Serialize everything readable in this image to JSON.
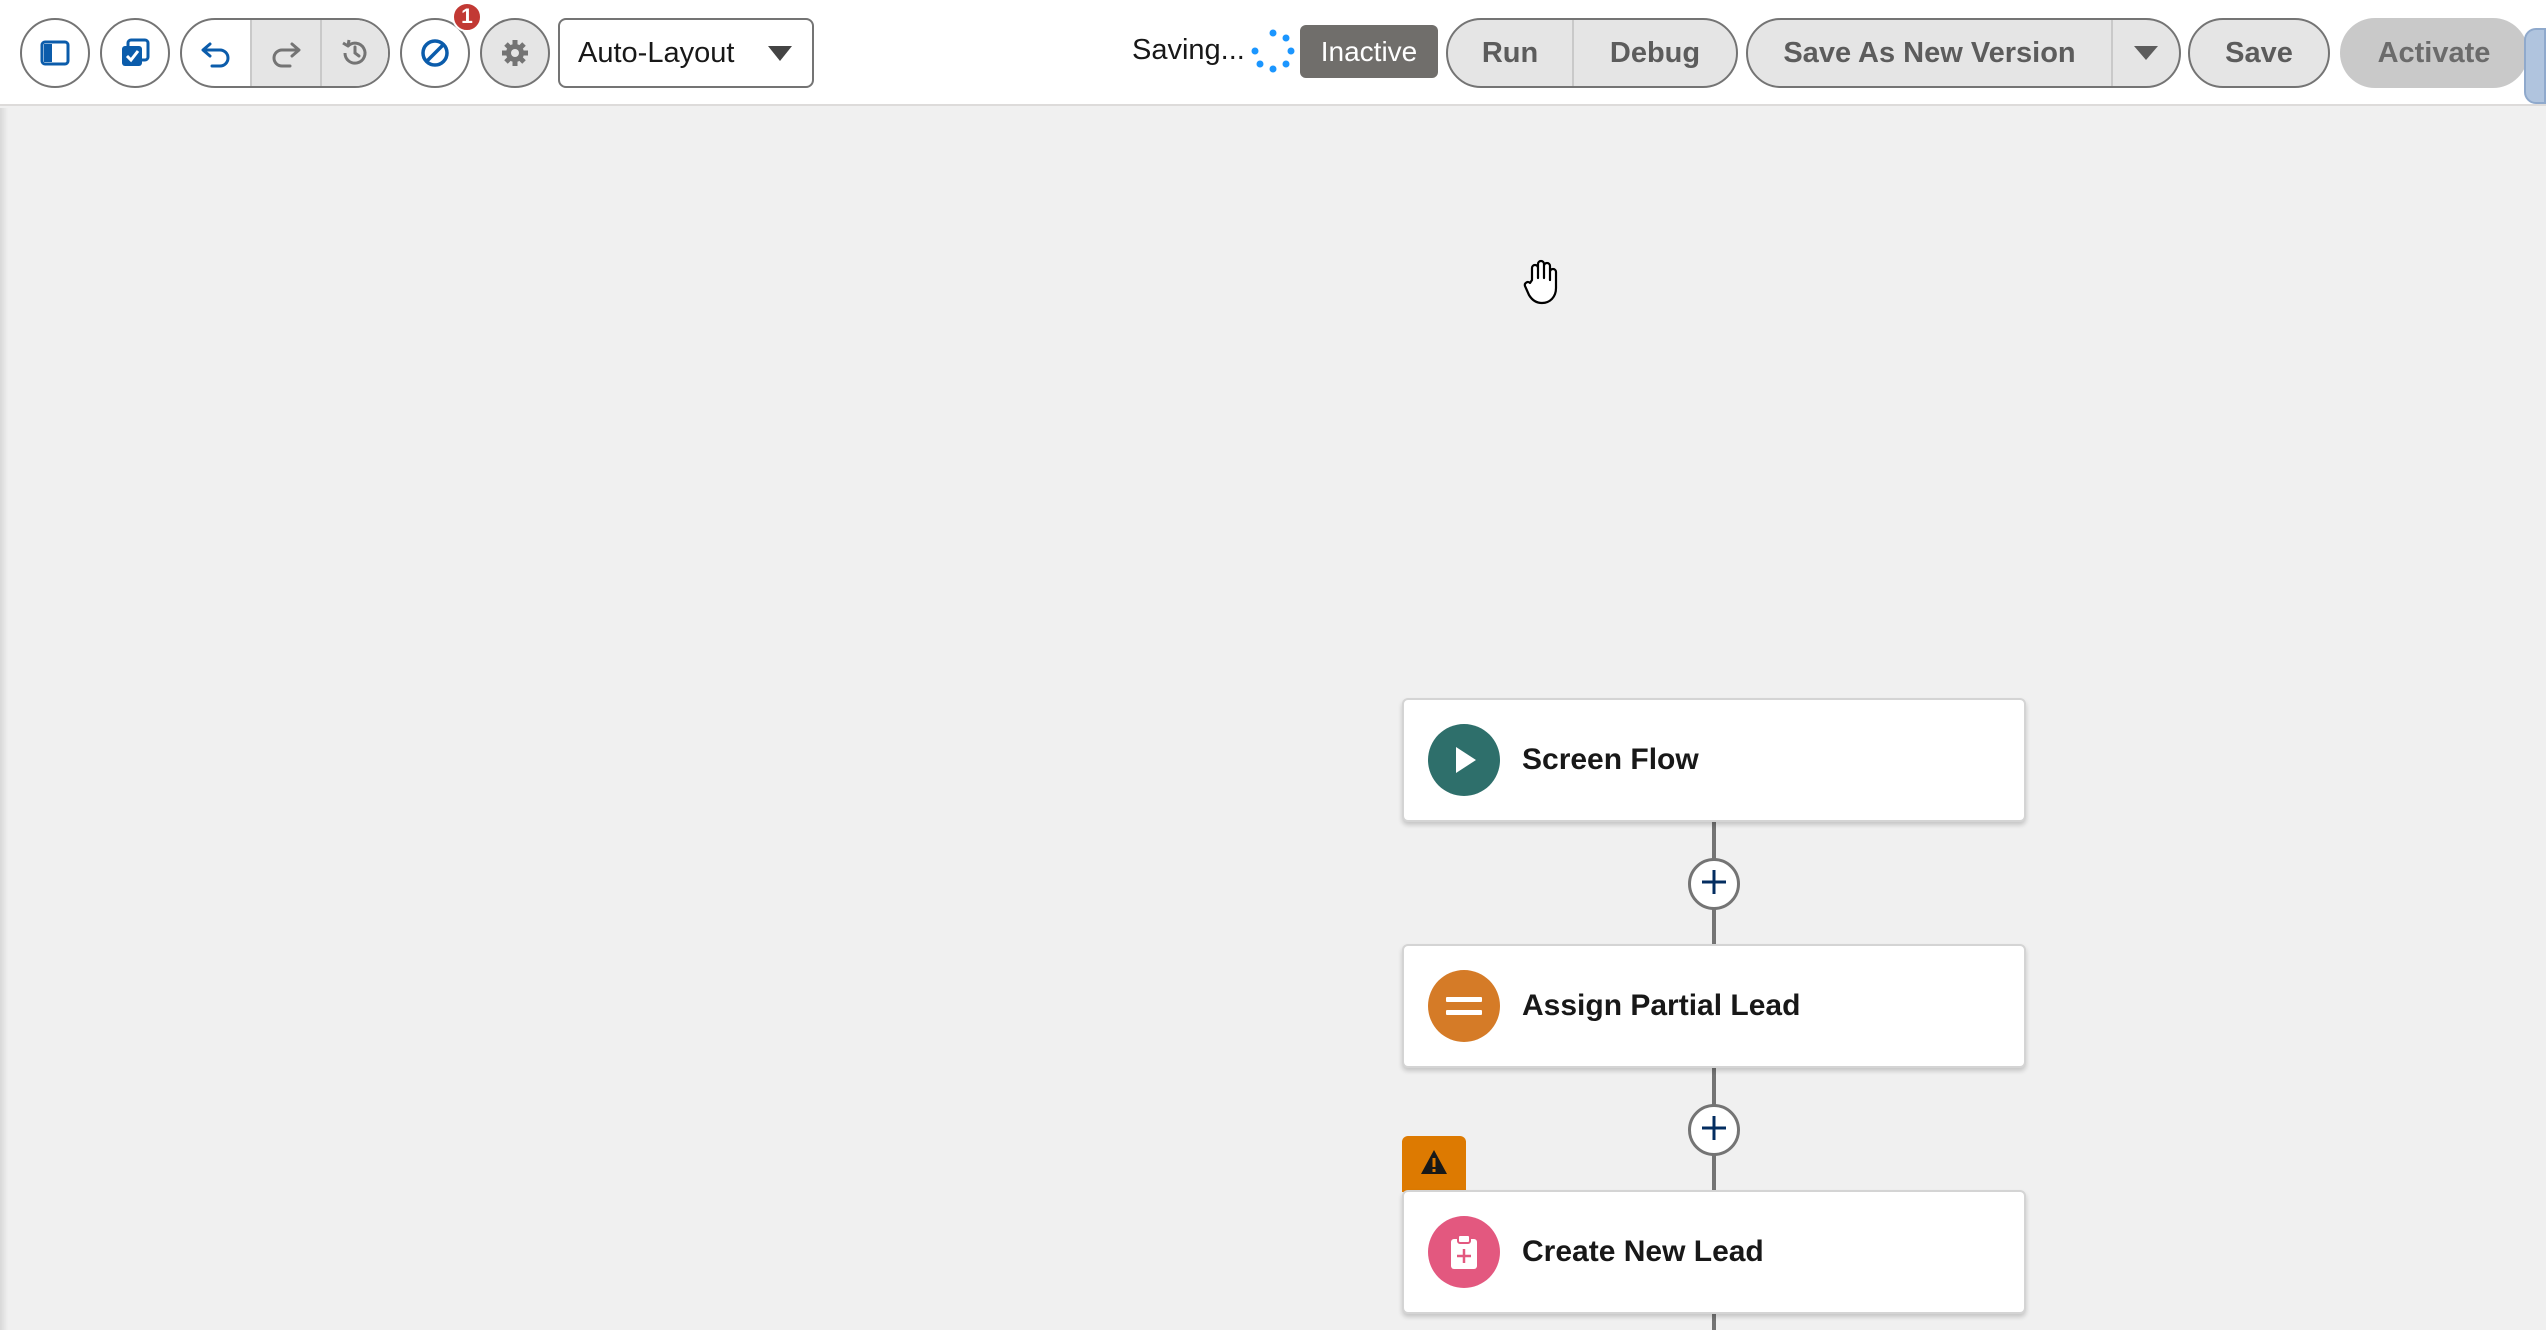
{
  "toolbar": {
    "layout_select": {
      "value": "Auto-Layout"
    },
    "errors_badge": "1",
    "saving_text": "Saving...",
    "status_badge": "Inactive",
    "run_label": "Run",
    "debug_label": "Debug",
    "save_as_new_version_label": "Save As New Version",
    "save_label": "Save",
    "activate_label": "Activate"
  },
  "canvas": {
    "nodes": [
      {
        "label": "Screen Flow",
        "type": "start",
        "icon": "play-icon",
        "color": "#2e6f6b"
      },
      {
        "label": "Assign Partial Lead",
        "type": "assignment",
        "icon": "equals-icon",
        "color": "#dd7a01"
      },
      {
        "label": "Create New Lead",
        "type": "create-records",
        "icon": "clipboard-add-icon",
        "color": "#e3587f",
        "has_warning": true
      }
    ]
  },
  "colors": {
    "accent": "#0b5cab",
    "badge": "#c23934",
    "warning": "#dd7a01",
    "status_inactive": "#706e6b"
  }
}
